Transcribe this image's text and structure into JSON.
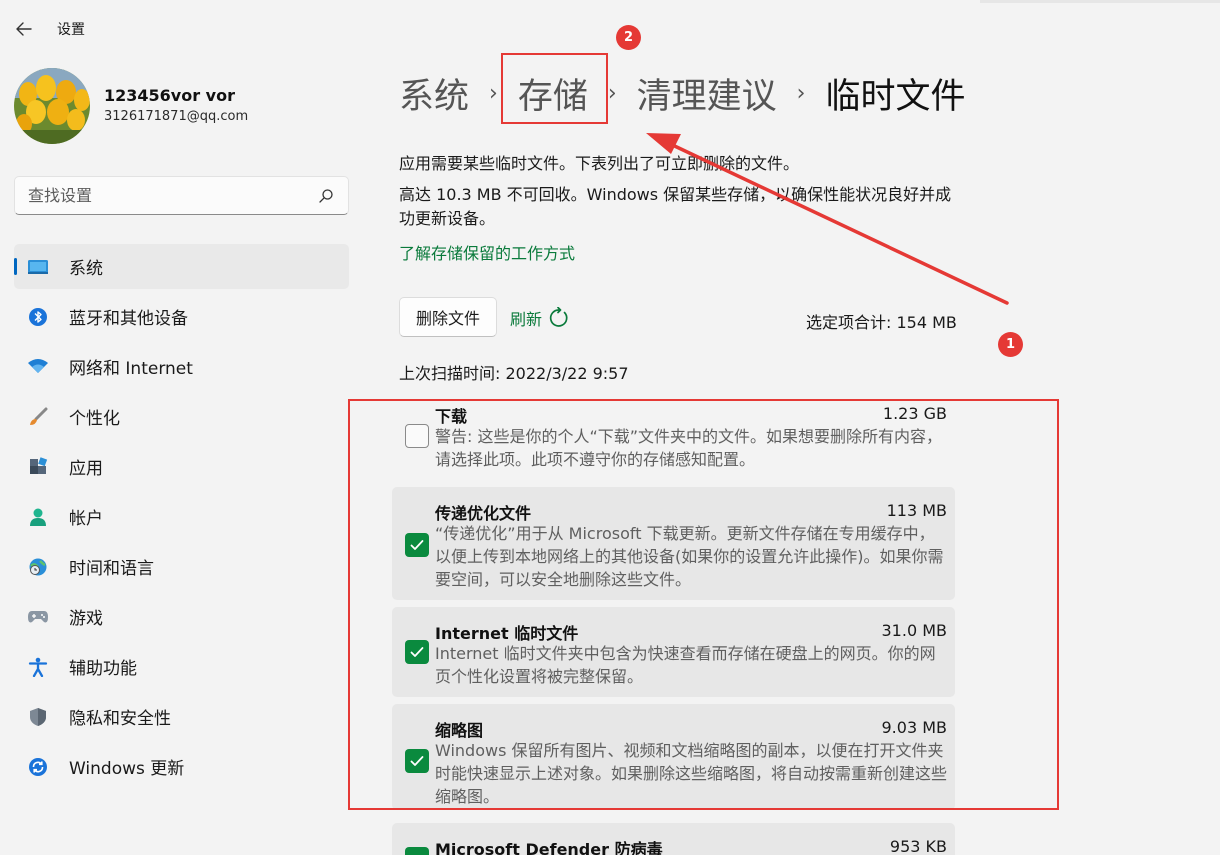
{
  "window": {
    "title": "设置"
  },
  "account": {
    "name": "123456vor vor",
    "email": "3126171871@qq.com"
  },
  "search": {
    "placeholder": "查找设置"
  },
  "nav": {
    "items": [
      {
        "label": "系统",
        "icon": "system-icon"
      },
      {
        "label": "蓝牙和其他设备",
        "icon": "bluetooth-icon"
      },
      {
        "label": "网络和 Internet",
        "icon": "wifi-icon"
      },
      {
        "label": "个性化",
        "icon": "brush-icon"
      },
      {
        "label": "应用",
        "icon": "apps-icon"
      },
      {
        "label": "帐户",
        "icon": "account-icon"
      },
      {
        "label": "时间和语言",
        "icon": "globe-clock-icon"
      },
      {
        "label": "游戏",
        "icon": "gamepad-icon"
      },
      {
        "label": "辅助功能",
        "icon": "accessibility-icon"
      },
      {
        "label": "隐私和安全性",
        "icon": "shield-icon"
      },
      {
        "label": "Windows 更新",
        "icon": "update-icon"
      }
    ]
  },
  "breadcrumb": {
    "item1": "系统",
    "item2": "存储",
    "item3": "清理建议",
    "current": "临时文件"
  },
  "content": {
    "desc1": "应用需要某些临时文件。下表列出了可立即删除的文件。",
    "desc2": "高达 10.3 MB 不可回收。Windows 保留某些存储，以确保性能状况良好并成功更新设备。",
    "learn_link": "了解存储保留的工作方式",
    "delete_button": "删除文件",
    "refresh_label": "刷新",
    "total": "选定项合计: 154 MB",
    "last_scan": "上次扫描时间: 2022/3/22 9:57"
  },
  "files": [
    {
      "title": "下载",
      "size": "1.23 GB",
      "desc": "警告: 这些是你的个人“下载”文件夹中的文件。如果想要删除所有内容，请选择此项。此项不遵守你的存储感知配置。",
      "checked": false
    },
    {
      "title": "传递优化文件",
      "size": "113 MB",
      "desc": "“传递优化”用于从 Microsoft 下载更新。更新文件存储在专用缓存中，以便上传到本地网络上的其他设备(如果你的设置允许此操作)。如果你需要空间，可以安全地删除这些文件。",
      "checked": true
    },
    {
      "title": "Internet 临时文件",
      "size": "31.0 MB",
      "desc": "Internet 临时文件夹中包含为快速查看而存储在硬盘上的网页。你的网页个性化设置将被完整保留。",
      "checked": true
    },
    {
      "title": "缩略图",
      "size": "9.03 MB",
      "desc": "Windows 保留所有图片、视频和文档缩略图的副本，以便在打开文件夹时能快速显示上述对象。如果删除这些缩略图，将自动按需重新创建这些缩略图。",
      "checked": true
    },
    {
      "title": "Microsoft Defender 防病毒",
      "size": "953 KB",
      "desc": "",
      "checked": true
    }
  ],
  "annotations": {
    "badge1": "1",
    "badge2": "2",
    "color": "#e53935"
  },
  "colors": {
    "accent": "#0067c0",
    "green": "#0a8a3e",
    "link": "#0a7a3b"
  }
}
